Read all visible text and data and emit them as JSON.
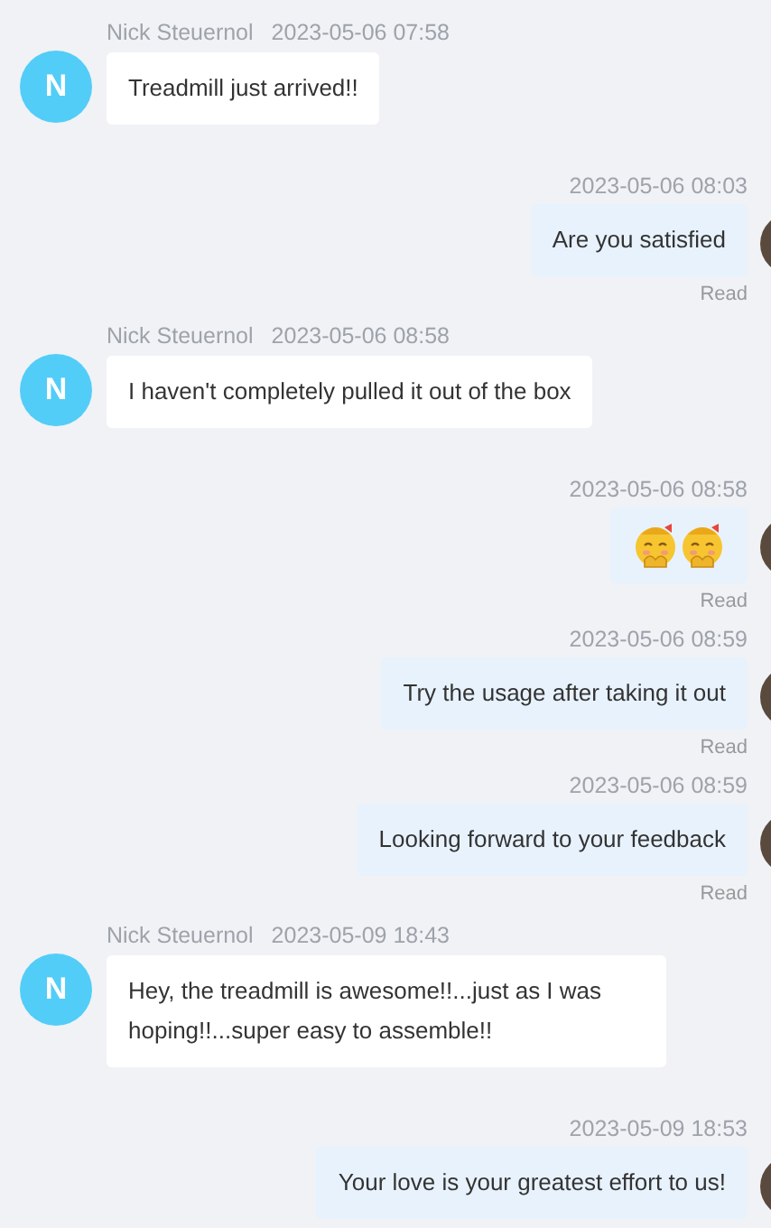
{
  "messages": [
    {
      "kind": "incoming",
      "sender": "Nick Steuernol",
      "time": "2023-05-06 07:58",
      "avatar": "N",
      "text": "Treadmill just arrived!!"
    },
    {
      "kind": "outgoing",
      "time": "2023-05-06 08:03",
      "text": "Are you satisfied",
      "status": "Read"
    },
    {
      "kind": "incoming",
      "sender": "Nick Steuernol",
      "time": "2023-05-06 08:58",
      "avatar": "N",
      "text": "I haven't completely pulled it out of the box"
    },
    {
      "kind": "stickers",
      "time": "2023-05-06 08:58",
      "stickers": [
        {
          "kind": "shy-face"
        },
        {
          "kind": "shy-face"
        }
      ],
      "status": "Read"
    },
    {
      "kind": "outgoing",
      "time": "2023-05-06 08:59",
      "text": "Try the usage after taking it out",
      "status": "Read"
    },
    {
      "kind": "outgoing",
      "time": "2023-05-06 08:59",
      "text": "Looking forward to your feedback",
      "status": "Read"
    },
    {
      "kind": "incoming",
      "sender": "Nick Steuernol",
      "time": "2023-05-09 18:43",
      "avatar": "N",
      "text": "Hey, the treadmill is awesome!!...just as I was hoping!!...super easy to assemble!!"
    },
    {
      "kind": "outgoing",
      "time": "2023-05-09 18:53",
      "text": "Your love is your greatest effort to us!"
    }
  ]
}
